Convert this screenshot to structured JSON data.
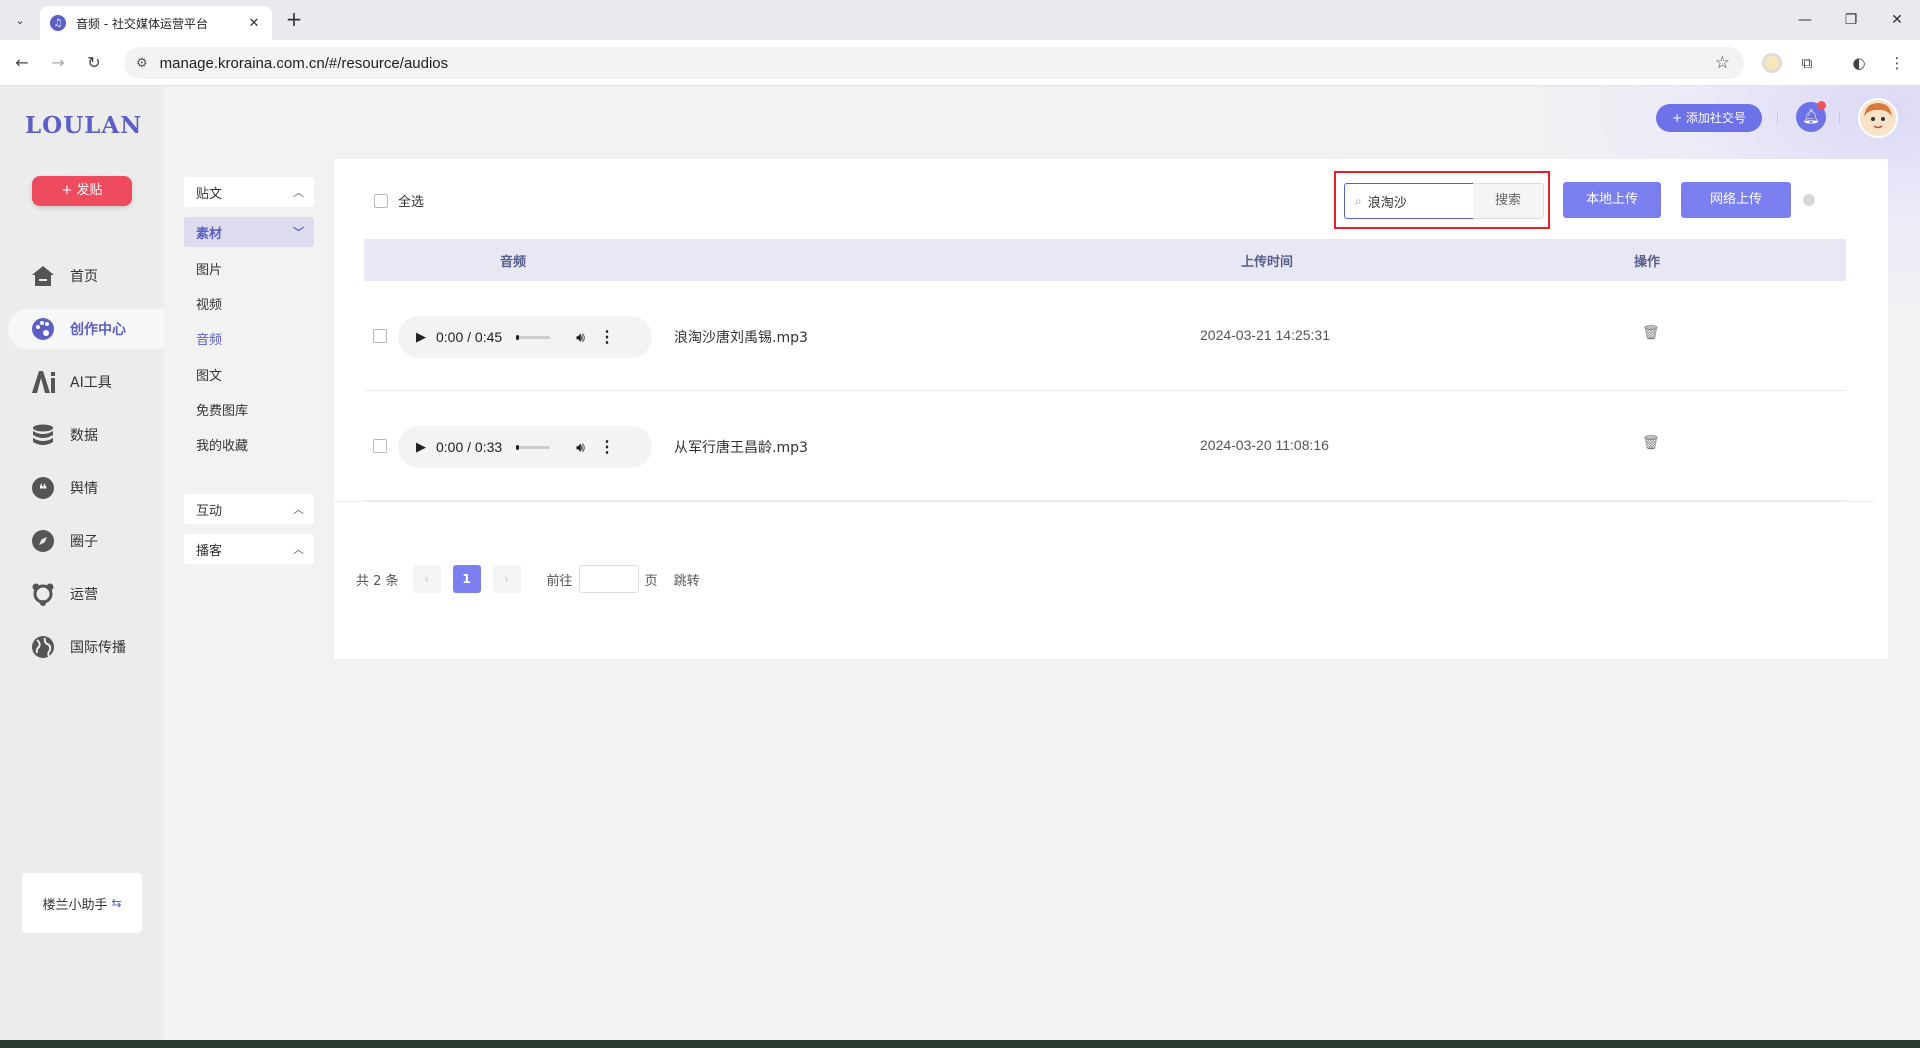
{
  "browser": {
    "tab_title": "音频 - 社交媒体运营平台",
    "url": "manage.kroraina.com.cn/#/resource/audios"
  },
  "app": {
    "logo": "LOULAN",
    "post_button": "+ 发贴",
    "nav": [
      {
        "label": "首页",
        "icon": "home-icon"
      },
      {
        "label": "创作中心",
        "icon": "palette-icon"
      },
      {
        "label": "AI工具",
        "icon": "ai-icon"
      },
      {
        "label": "数据",
        "icon": "database-icon"
      },
      {
        "label": "舆情",
        "icon": "quote-icon"
      },
      {
        "label": "圈子",
        "icon": "compass-icon"
      },
      {
        "label": "运营",
        "icon": "operations-icon"
      },
      {
        "label": "国际传播",
        "icon": "globe-icon"
      }
    ],
    "helper": "楼兰小助手",
    "header": {
      "add_social": "+ 添加社交号"
    }
  },
  "subnav": {
    "groups": [
      {
        "label": "贴文"
      },
      {
        "label": "素材"
      },
      {
        "label": "互动"
      },
      {
        "label": "播客"
      }
    ],
    "material_items": [
      "图片",
      "视频",
      "音频",
      "图文",
      "免费图库",
      "我的收藏"
    ]
  },
  "toolbar": {
    "select_all": "全选",
    "search_value": "浪淘沙",
    "search_button": "搜索",
    "local_upload": "本地上传",
    "network_upload": "网络上传"
  },
  "table": {
    "headers": [
      "音频",
      "上传时间",
      "操作"
    ],
    "rows": [
      {
        "time_display": "0:00 / 0:45",
        "filename": "浪淘沙唐刘禹锡.mp3",
        "upload_time": "2024-03-21 14:25:31"
      },
      {
        "time_display": "0:00 / 0:33",
        "filename": "从军行唐王昌龄.mp3",
        "upload_time": "2024-03-20 11:08:16"
      }
    ]
  },
  "pagination": {
    "total": "共 2 条",
    "current_page": "1",
    "goto_label": "前往",
    "page_unit": "页",
    "jump": "跳转"
  }
}
